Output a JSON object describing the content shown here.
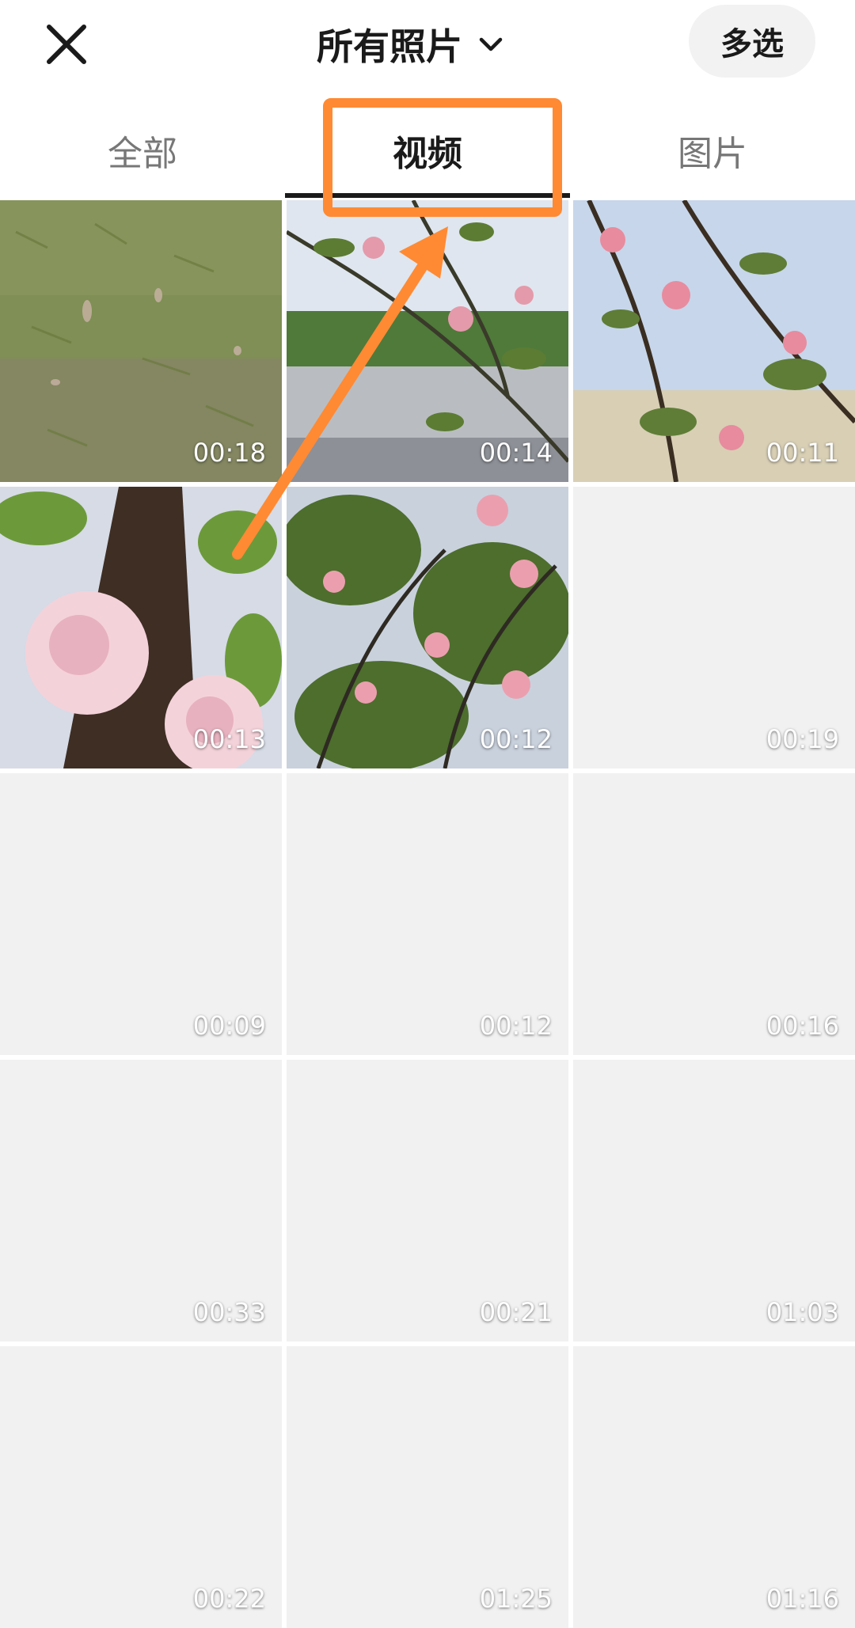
{
  "header": {
    "title": "所有照片",
    "multi_select_label": "多选",
    "close_icon": "close-icon",
    "dropdown_icon": "chevron-down-icon"
  },
  "tabs": [
    {
      "label": "全部",
      "active": false
    },
    {
      "label": "视频",
      "active": true
    },
    {
      "label": "图片",
      "active": false
    }
  ],
  "grid": {
    "items": [
      {
        "duration": "00:18"
      },
      {
        "duration": "00:14"
      },
      {
        "duration": "00:11"
      },
      {
        "duration": "00:13"
      },
      {
        "duration": "00:12"
      },
      {
        "duration": "00:19"
      },
      {
        "duration": "00:09"
      },
      {
        "duration": "00:12"
      },
      {
        "duration": "00:16"
      },
      {
        "duration": "00:33"
      },
      {
        "duration": "00:21"
      },
      {
        "duration": "01:03"
      },
      {
        "duration": "00:22"
      },
      {
        "duration": "01:25"
      },
      {
        "duration": "01:16"
      }
    ]
  },
  "colors": {
    "annotation_orange": "#FF8A33",
    "placeholder_gray": "#F1F1F1",
    "multi_button_bg": "#F2F2F2"
  }
}
